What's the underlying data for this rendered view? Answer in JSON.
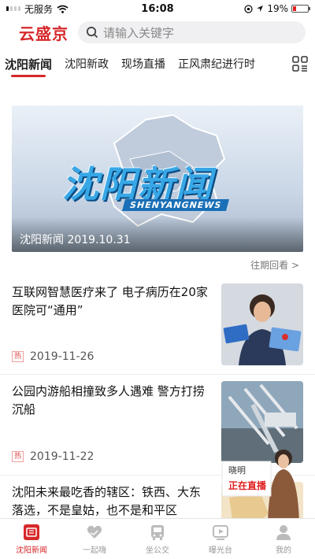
{
  "status_bar": {
    "carrier": "无服务",
    "time": "16:08",
    "battery": "19%"
  },
  "app": {
    "logo": "云盛京"
  },
  "search": {
    "placeholder": "请输入关键字"
  },
  "tabs": [
    {
      "label": "沈阳新闻",
      "active": true
    },
    {
      "label": "沈阳新政",
      "active": false
    },
    {
      "label": "现场直播",
      "active": false
    },
    {
      "label": "正风肃纪进行时",
      "active": false
    }
  ],
  "banner": {
    "title": "沈阳新闻",
    "subtitle": "SHENYANGNEWS",
    "caption": "沈阳新闻 2019.10.31"
  },
  "more_link": "往期回看 >",
  "news": [
    {
      "title": "互联网智慧医疗来了 电子病历在20家医院可“通用”",
      "tag": "热",
      "date": "2019-11-26"
    },
    {
      "title": "公园内游船相撞致多人遇难 警方打捞沉船",
      "tag": "热",
      "date": "2019-11-22"
    },
    {
      "title": "沈阳未来最吃香的辖区：铁西、大东落选，不是皇姑，也不是和平区",
      "tag": "",
      "date": ""
    }
  ],
  "live_widget": {
    "name": "晓明",
    "status": "正在直播"
  },
  "bottom_nav": [
    {
      "label": "沈阳新闻",
      "icon": "news-icon",
      "active": true
    },
    {
      "label": "一起嗨",
      "icon": "heart-hands-icon",
      "active": false
    },
    {
      "label": "坐公交",
      "icon": "bus-icon",
      "active": false
    },
    {
      "label": "曝光台",
      "icon": "video-play-icon",
      "active": false
    },
    {
      "label": "我的",
      "icon": "user-icon",
      "active": false
    }
  ],
  "colors": {
    "accent": "#d7282a",
    "hot_tag": "#e04646"
  }
}
